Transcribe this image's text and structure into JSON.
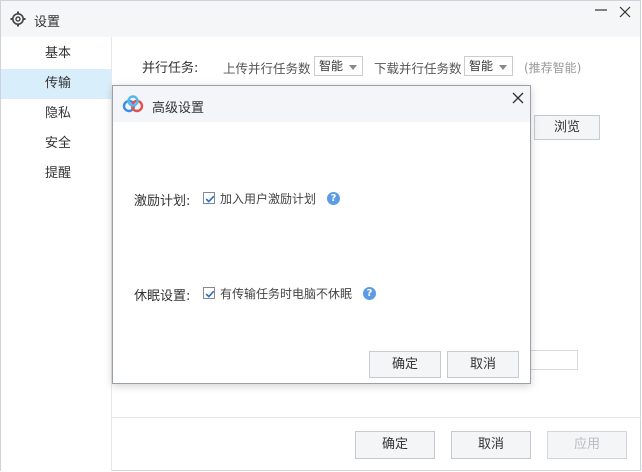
{
  "window": {
    "title": "设置"
  },
  "sidebar": {
    "items": [
      {
        "label": "基本"
      },
      {
        "label": "传输",
        "active": true
      },
      {
        "label": "隐私"
      },
      {
        "label": "安全"
      },
      {
        "label": "提醒"
      }
    ]
  },
  "transfer": {
    "parallel_label": "并行任务:",
    "upload_label": "上传并行任务数",
    "upload_value": "智能",
    "download_label": "下载并行任务数",
    "download_value": "智能",
    "recommend_hint": "(推荐智能)",
    "browse_label": "浏览"
  },
  "footer": {
    "ok_label": "确定",
    "cancel_label": "取消",
    "apply_label": "应用"
  },
  "dialog": {
    "title": "高级设置",
    "incentive_label": "激励计划:",
    "incentive_checkbox_label": "加入用户激励计划",
    "incentive_checked": true,
    "sleep_label": "休眠设置:",
    "sleep_checkbox_label": "有传输任务时电脑不休眠",
    "sleep_checked": true,
    "help_glyph": "?",
    "ok_label": "确定",
    "cancel_label": "取消"
  }
}
